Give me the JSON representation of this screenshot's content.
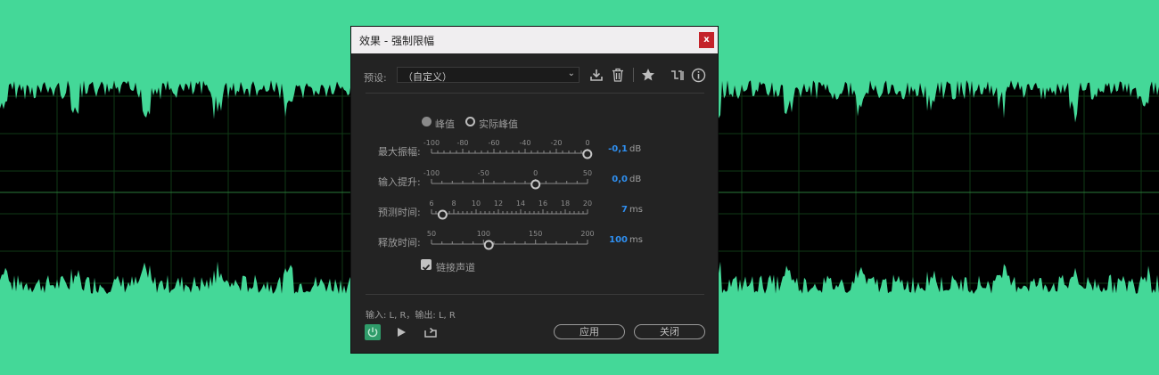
{
  "dialog": {
    "title": "效果 - 强制限幅",
    "close_glyph": "x",
    "preset_label": "预设:",
    "preset_value": "（自定义）",
    "mode_options": [
      {
        "label": "峰值",
        "selected": true
      },
      {
        "label": "实际峰值",
        "selected": false
      }
    ],
    "params": [
      {
        "label": "最大振幅:",
        "ticks": [
          "-100",
          "-80",
          "-60",
          "-40",
          "-20",
          "0"
        ],
        "value": "-0,1",
        "unit": "dB",
        "fraction": 0.999
      },
      {
        "label": "输入提升:",
        "ticks": [
          "-100",
          "-50",
          "0",
          "50"
        ],
        "value": "0,0",
        "unit": "dB",
        "fraction": 0.667
      },
      {
        "label": "预测时间:",
        "ticks": [
          "6",
          "8",
          "10",
          "12",
          "14",
          "16",
          "18",
          "20"
        ],
        "value": "7",
        "unit": "ms",
        "fraction": 0.071
      },
      {
        "label": "释放时间:",
        "ticks": [
          "50",
          "100",
          "150",
          "200"
        ],
        "value": "100",
        "unit": "ms",
        "fraction": 0.367
      }
    ],
    "link_channels": {
      "label": "链接声道",
      "checked": true
    },
    "io_text": "输入: L, R，输出: L, R",
    "apply_label": "应用",
    "close_label": "关闭",
    "accent_color": "#2f8ff0",
    "power_color": "#2f9c6a"
  },
  "waveform": {
    "color": "#44d898",
    "grid_color": "#0f3a16",
    "center_line_color": "#2a7a3a"
  }
}
